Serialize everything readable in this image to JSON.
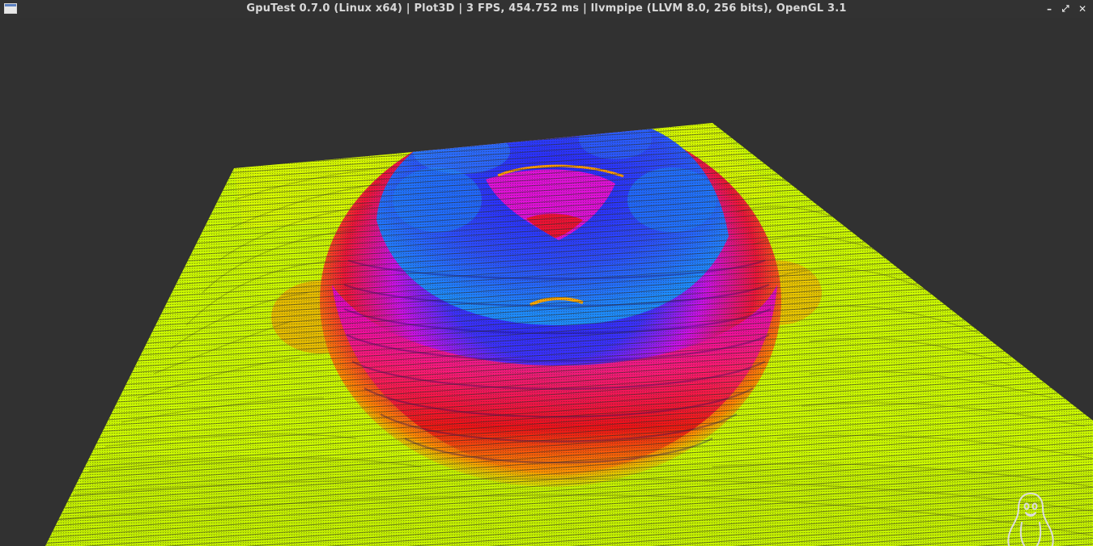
{
  "window": {
    "title": "GpuTest 0.7.0 (Linux x64) | Plot3D | 3 FPS, 454.752 ms | llvmpipe (LLVM 8.0, 256 bits), OpenGL 3.1",
    "icon": "window-app-icon",
    "controls": {
      "minimize": "–",
      "maximize": "⤢",
      "close": "✕"
    }
  },
  "scene": {
    "background_color": "#313131",
    "surface_colors": {
      "low": "#ccff00",
      "mid_low": "#ff9900",
      "mid": "#ee1111",
      "mid_high": "#dd00dd",
      "high": "#2244ff",
      "peak": "#1177ff"
    },
    "overlay_logo": "tux-penguin-icon"
  }
}
